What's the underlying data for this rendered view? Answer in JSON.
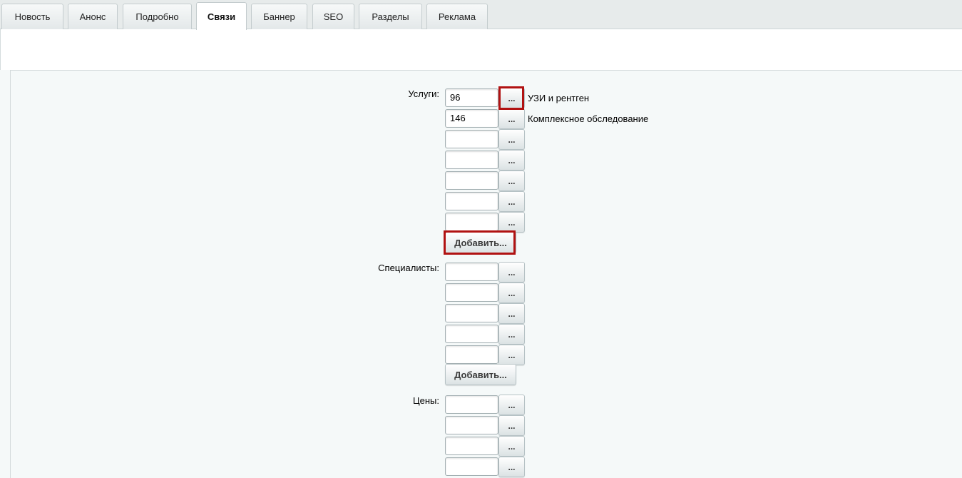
{
  "tabs": [
    {
      "label": "Новость",
      "active": false
    },
    {
      "label": "Анонс",
      "active": false
    },
    {
      "label": "Подробно",
      "active": false
    },
    {
      "label": "Связи",
      "active": true
    },
    {
      "label": "Баннер",
      "active": false
    },
    {
      "label": "SEO",
      "active": false
    },
    {
      "label": "Разделы",
      "active": false
    },
    {
      "label": "Реклама",
      "active": false
    }
  ],
  "services": {
    "label": "Услуги:",
    "rows": [
      {
        "value": "96",
        "description": "УЗИ и рентген"
      },
      {
        "value": "146",
        "description": "Комплексное обследование"
      },
      {
        "value": "",
        "description": ""
      },
      {
        "value": "",
        "description": ""
      },
      {
        "value": "",
        "description": ""
      },
      {
        "value": "",
        "description": ""
      },
      {
        "value": "",
        "description": ""
      }
    ],
    "add_label": "Добавить..."
  },
  "specialists": {
    "label": "Специалисты:",
    "rows": [
      {
        "value": ""
      },
      {
        "value": ""
      },
      {
        "value": ""
      },
      {
        "value": ""
      },
      {
        "value": ""
      }
    ],
    "add_label": "Добавить..."
  },
  "prices": {
    "label": "Цены:",
    "rows": [
      {
        "value": ""
      },
      {
        "value": ""
      },
      {
        "value": ""
      },
      {
        "value": ""
      }
    ]
  },
  "browse_button_label": "...",
  "colors": {
    "highlight": "#b11212",
    "tab_bar": "#e7ebeb",
    "content_bg": "#f5f9f9"
  }
}
